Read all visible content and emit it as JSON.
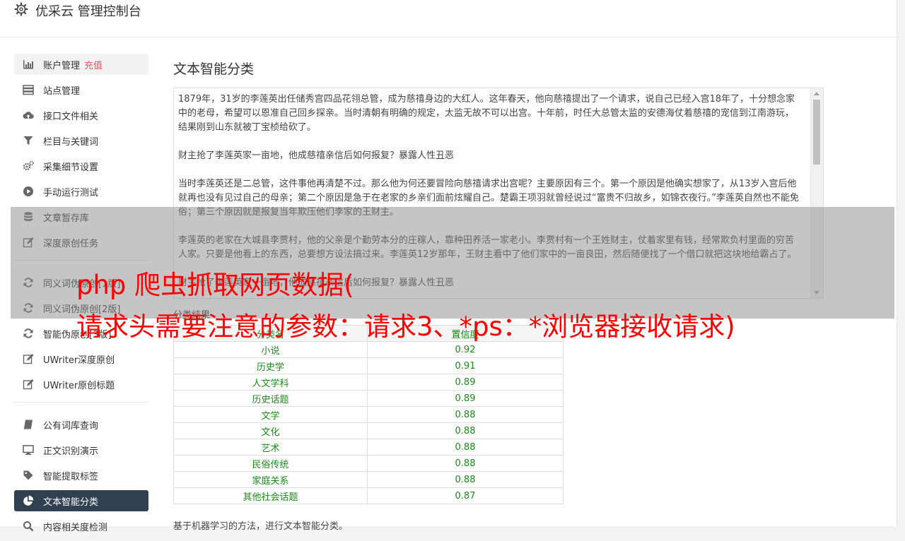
{
  "header": {
    "title": "优采云 管理控制台",
    "icon": "gear-icon"
  },
  "sidebar": {
    "items": [
      {
        "label": "账户管理",
        "badge": "充值",
        "icon": "bar-chart-icon"
      },
      {
        "label": "站点管理",
        "icon": "server-icon"
      },
      {
        "label": "接口文件相关",
        "icon": "cloud-upload-icon"
      },
      {
        "label": "栏目与关键词",
        "icon": "filter-icon"
      },
      {
        "label": "采集细节设置",
        "icon": "cogs-icon"
      },
      {
        "label": "手动运行测试",
        "icon": "play-circle-icon"
      },
      {
        "label": "文章暂存库",
        "icon": "database-icon"
      },
      {
        "label": "深度原创任务",
        "icon": "edit-icon"
      },
      {
        "label": "同义词伪原创[1版]",
        "icon": "refresh-icon"
      },
      {
        "label": "同义词伪原创[2版]",
        "icon": "refresh-icon"
      },
      {
        "label": "智能伪原创[3版]",
        "icon": "refresh-icon"
      },
      {
        "label": "UWriter深度原创",
        "icon": "edit-icon"
      },
      {
        "label": "UWriter原创标题",
        "icon": "edit-icon"
      },
      {
        "label": "公有词库查询",
        "icon": "book-icon"
      },
      {
        "label": "正文识别演示",
        "icon": "desktop-icon"
      },
      {
        "label": "智能提取标签",
        "icon": "tag-icon"
      },
      {
        "label": "文本智能分类",
        "icon": "pie-chart-icon"
      },
      {
        "label": "内容相关度检测",
        "icon": "search-icon"
      }
    ]
  },
  "main": {
    "title": "文本智能分类",
    "paragraphs": [
      "1879年，31岁的李莲英出任储秀宫四品花翎总管，成为慈禧身边的大红人。这年春天，他向慈禧提出了一个请求，说自己已经入宫18年了，十分想念家中的老母，希望可以恩准自己回乡探亲。当时清朝有明确的规定，太监无故不可以出宫。十年前，时任大总管太监的安德海仗着慈禧的宠信到江南游玩，结果刚到山东就被丁宝桢给砍了。",
      "财主抢了李莲英家一亩地，他成慈禧亲信后如何报复？暴露人性丑恶",
      "当时李莲英还是二总管，这件事他再清楚不过。那么他为何还要冒险向慈禧请求出宫呢？主要原因有三个。第一个原因是他确实想家了，从13岁入宫后他就再也没有见过自己的母亲；第二个原因是急于在老家的乡亲们面前炫耀自己。楚霸王项羽就曾经说过“富贵不归故乡，如锦衣夜行。”李莲英自然也不能免俗；第三个原因就是报复当年欺压他们李家的王财主。",
      "李莲英的老家在大城县李贾村，他的父亲是个勤劳本分的庄稼人，靠种田养活一家老小。李贾村有一个王姓财主，仗着家里有钱，经常欺负村里面的穷苦人家。只要是他看上的东西，总要想方设法搞过来。李莲英12岁那年，王财主看中了他们家中的一亩良田，然后随便找了一个借口就把这块地给霸占了。",
      "财主抢了李莲英家一亩地，他成慈禧亲信后如何报复？暴露人性丑恶"
    ],
    "result_label": "分类结果",
    "table": {
      "headers": [
        "分类名",
        "置信度"
      ],
      "rows": [
        [
          "小说",
          "0.92"
        ],
        [
          "历史学",
          "0.91"
        ],
        [
          "人文学科",
          "0.89"
        ],
        [
          "历史话题",
          "0.89"
        ],
        [
          "文学",
          "0.88"
        ],
        [
          "文化",
          "0.88"
        ],
        [
          "艺术",
          "0.88"
        ],
        [
          "民俗传统",
          "0.88"
        ],
        [
          "家庭关系",
          "0.88"
        ],
        [
          "其他社会话题",
          "0.87"
        ]
      ]
    },
    "footnote": "基于机器学习的方法，进行文本智能分类。"
  },
  "watermark": {
    "line1": "php 爬虫抓取网页数据(",
    "line2": "请求头需要注意的参数：请求3、*ps：*浏览器接收请求)"
  }
}
